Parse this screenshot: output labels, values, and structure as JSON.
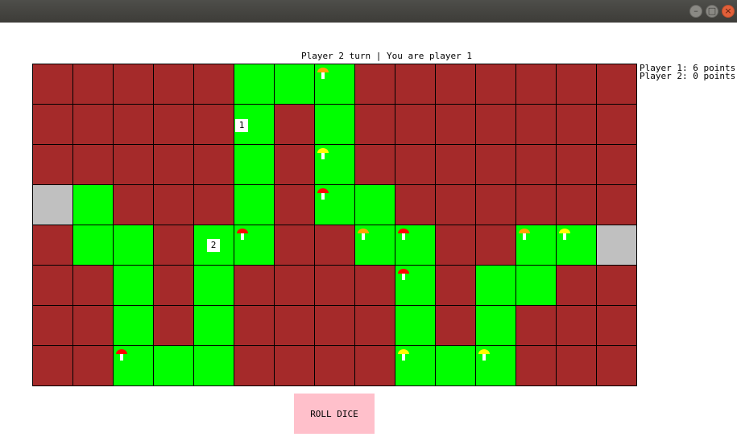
{
  "window": {
    "buttons": [
      "–",
      "□",
      "×"
    ]
  },
  "status_text": "Player 2 turn | You are player 1",
  "scores": [
    "Player 1: 6 points",
    "Player 2: 0 points"
  ],
  "roll_button_label": "ROLL DICE",
  "colors": {
    "wall": "#a52a2a",
    "path": "#00ff00",
    "endpoint": "#c0c0c0",
    "button": "#ffc0cb"
  },
  "board": {
    "cols": 15,
    "rows": 8,
    "layout": [
      "WWWWWGGGWWWWWWW",
      "WWWWWGWGWWWWWWW",
      "WWWWWGWGWWWWWWW",
      "SGWWWGWGGWWWWWW",
      "WGGWGGWWGGWWGGS",
      "WWGWGWWWWGWGGWW",
      "WWGWGWWWWGWGWWW",
      "WWGGGWWWWGGGWWW"
    ],
    "mushrooms": [
      {
        "row": 0,
        "col": 7,
        "color": "orange"
      },
      {
        "row": 2,
        "col": 7,
        "color": "yellow"
      },
      {
        "row": 3,
        "col": 7,
        "color": "red"
      },
      {
        "row": 4,
        "col": 5,
        "color": "red"
      },
      {
        "row": 4,
        "col": 8,
        "color": "orange"
      },
      {
        "row": 4,
        "col": 9,
        "color": "red"
      },
      {
        "row": 4,
        "col": 12,
        "color": "orange"
      },
      {
        "row": 4,
        "col": 13,
        "color": "yellow"
      },
      {
        "row": 5,
        "col": 9,
        "color": "red"
      },
      {
        "row": 7,
        "col": 2,
        "color": "red"
      },
      {
        "row": 7,
        "col": 9,
        "color": "yellow"
      },
      {
        "row": 7,
        "col": 11,
        "color": "yellow"
      }
    ],
    "players": [
      {
        "label": "1",
        "row": 1,
        "col": 5,
        "anchor": "top-left"
      },
      {
        "label": "2",
        "row": 4,
        "col": 4,
        "anchor": "center-left"
      }
    ]
  }
}
